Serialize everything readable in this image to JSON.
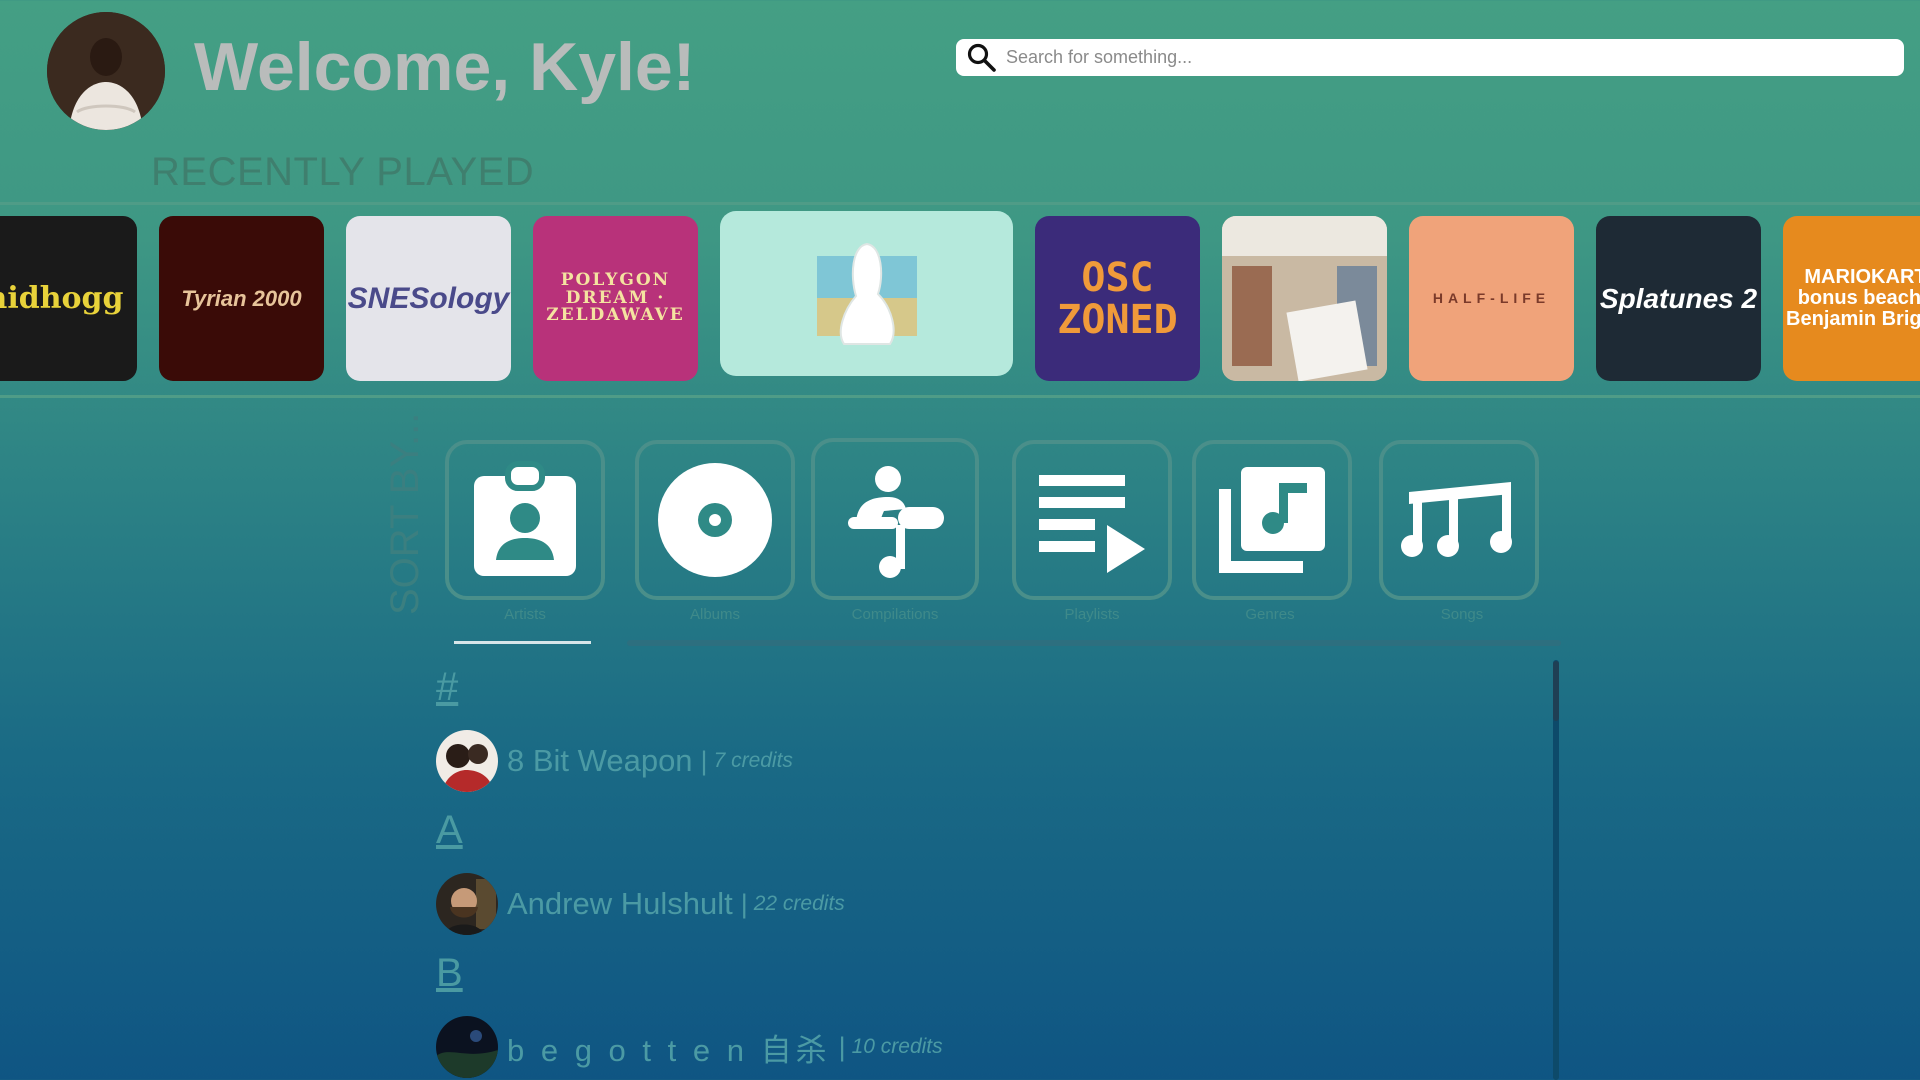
{
  "header": {
    "welcome": "Welcome, Kyle!",
    "search_placeholder": "Search for something..."
  },
  "recently_played": {
    "title": "RECENTLY PLAYED",
    "albums": [
      {
        "label": "nidhogg",
        "bg": "#1a1a1a",
        "color": "#e8d23a"
      },
      {
        "label": "Tyrian 2000",
        "bg": "#3a0b07",
        "color": "#e7c49a"
      },
      {
        "label": "SNESology",
        "bg": "#e4e4ea",
        "color": "#4a4a8a"
      },
      {
        "label": "POLYGON DREAM · ZELDAWAVE",
        "bg": "#b8327a",
        "color": "#f4e3a0"
      },
      {
        "label": "",
        "bg": "#b5e9dc",
        "color": "#ffffff"
      },
      {
        "label": "OSC ZONED",
        "bg": "#3b2b7a",
        "color": "#f09a3a"
      },
      {
        "label": "",
        "bg": "#c8b7a0",
        "color": "#333333"
      },
      {
        "label": "HALF-LIFE",
        "bg": "#f0a37a",
        "color": "#7a3a2a"
      },
      {
        "label": "Splatunes 2",
        "bg": "#1e2a35",
        "color": "#ffffff"
      },
      {
        "label": "MARIOKART bonus beach · Benjamin Briggs",
        "bg": "#e68a1e",
        "color": "#ffffff"
      }
    ]
  },
  "sort": {
    "title": "SORT BY...",
    "options": [
      {
        "label": "Artists",
        "icon": "artist-badge-icon"
      },
      {
        "label": "Albums",
        "icon": "disc-icon"
      },
      {
        "label": "Compilations",
        "icon": "compilation-icon"
      },
      {
        "label": "Playlists",
        "icon": "playlist-icon"
      },
      {
        "label": "Genres",
        "icon": "music-library-icon"
      },
      {
        "label": "Songs",
        "icon": "notes-icon"
      }
    ],
    "active": "Artists"
  },
  "artists": {
    "sections": [
      {
        "letter": "#",
        "items": [
          {
            "name": "8 Bit Weapon",
            "credits": "7 credits"
          }
        ]
      },
      {
        "letter": "A",
        "items": [
          {
            "name": "Andrew Hulshult",
            "credits": "22 credits"
          }
        ]
      },
      {
        "letter": "B",
        "items": [
          {
            "name": "b e g o t t e n 自杀",
            "credits": "10 credits"
          }
        ]
      }
    ],
    "separator": "|"
  },
  "colors": {
    "accent": "#4a8f8a",
    "welcome_text": "#b9bcbb",
    "list_text": "#4b9aa4"
  }
}
